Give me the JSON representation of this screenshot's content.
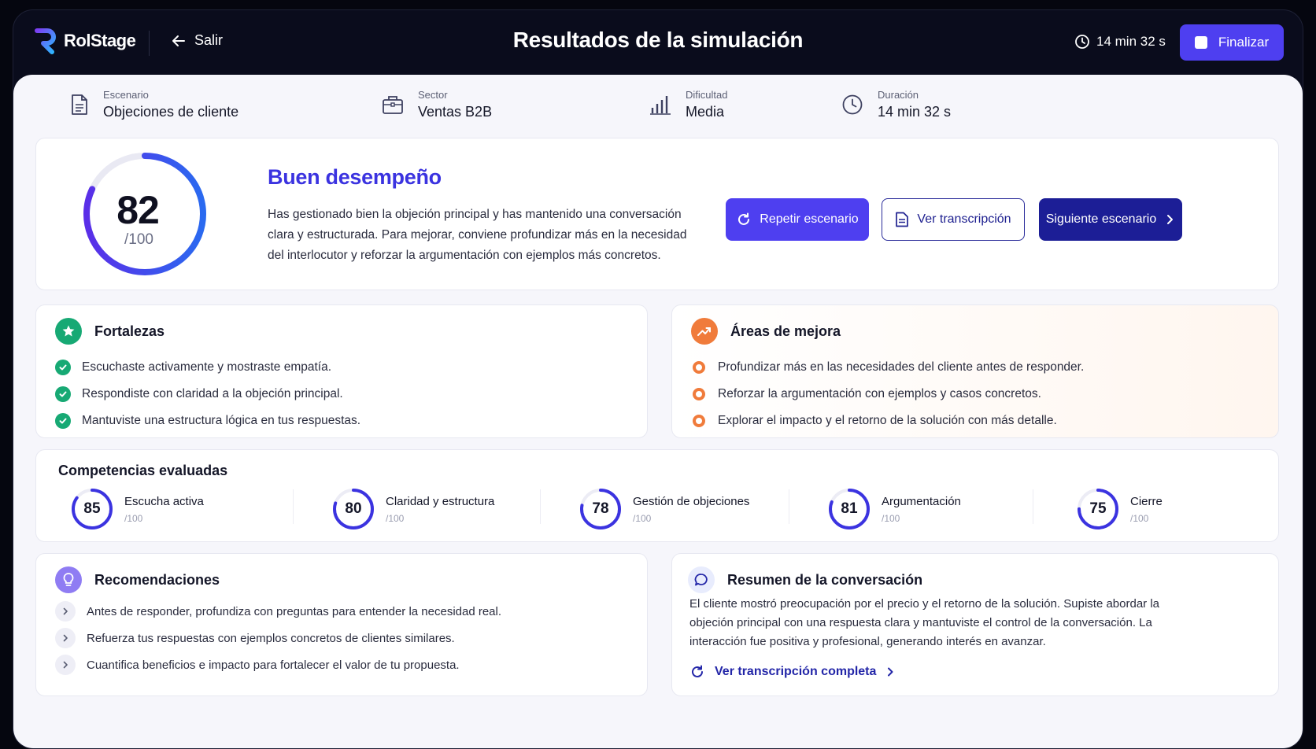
{
  "app": {
    "name": "RolStage"
  },
  "header": {
    "back_label": "Salir",
    "title": "Resultados de la simulación",
    "timer": "14 min 32 s",
    "finish_label": "Finalizar"
  },
  "meta": [
    {
      "label": "Escenario",
      "value": "Objeciones de cliente",
      "icon": "document-icon"
    },
    {
      "label": "Sector",
      "value": "Ventas B2B",
      "icon": "briefcase-icon"
    },
    {
      "label": "Dificultad",
      "value": "Media",
      "icon": "bar-chart-icon"
    },
    {
      "label": "Duración",
      "value": "14 min 32 s",
      "icon": "clock-icon"
    }
  ],
  "score": {
    "value": "82",
    "max": "/100",
    "fraction": 0.82,
    "title": "Buen desempeño",
    "description": "Has gestionado bien la objeción principal y has mantenido una conversación clara y estructurada. Para mejorar, conviene profundizar más en la necesidad del interlocutor y reforzar la argumentación con ejemplos más concretos."
  },
  "actions": {
    "repeat": "Repetir escenario",
    "transcript": "Ver transcripción",
    "next": "Siguiente escenario"
  },
  "strengths": {
    "title": "Fortalezas",
    "items": [
      "Escuchaste activamente y mostraste empatía.",
      "Respondiste con claridad a la objeción principal.",
      "Mantuviste una estructura lógica en tus respuestas."
    ]
  },
  "improvements": {
    "title": "Áreas de mejora",
    "items": [
      "Profundizar más en las necesidades del cliente antes de responder.",
      "Reforzar la argumentación con ejemplos y casos concretos.",
      "Explorar el impacto y el retorno de la solución con más detalle."
    ]
  },
  "competencies": {
    "title": "Competencias evaluadas",
    "items": [
      {
        "name": "Escucha activa",
        "score": "85",
        "max": "/100",
        "fraction": 0.85
      },
      {
        "name": "Claridad y estructura",
        "score": "80",
        "max": "/100",
        "fraction": 0.8
      },
      {
        "name": "Gestión de objeciones",
        "score": "78",
        "max": "/100",
        "fraction": 0.78
      },
      {
        "name": "Argumentación",
        "score": "81",
        "max": "/100",
        "fraction": 0.81
      },
      {
        "name": "Cierre",
        "score": "75",
        "max": "/100",
        "fraction": 0.75
      }
    ]
  },
  "recommendations": {
    "title": "Recomendaciones",
    "items": [
      "Antes de responder, profundiza con preguntas para entender la necesidad real.",
      "Refuerza tus respuestas con ejemplos concretos de clientes similares.",
      "Cuantifica beneficios e impacto para fortalecer el valor de tu propuesta."
    ]
  },
  "summary": {
    "title": "Resumen de la conversación",
    "text": "El cliente mostró preocupación por el precio y el retorno de la solución. Supiste abordar la objeción principal con una respuesta clara y mantuviste el control de la conversación. La interacción fue positiva y profesional, generando interés en avanzar.",
    "link": "Ver transcripción completa"
  },
  "colors": {
    "accent": "#4e3ff0",
    "accent_dark": "#1c1e96",
    "success": "#17a974",
    "warning": "#f07b3b"
  }
}
